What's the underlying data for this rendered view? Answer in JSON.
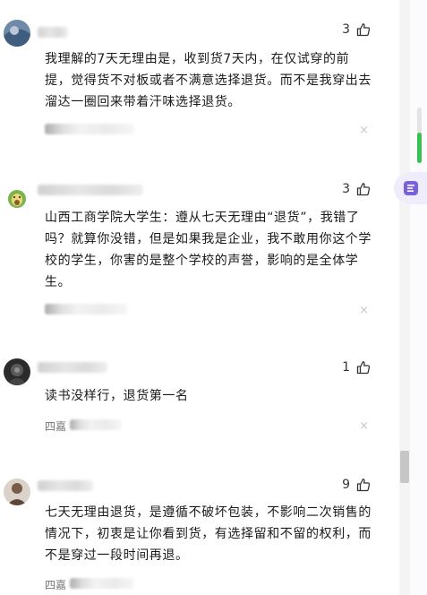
{
  "comments": [
    {
      "likes": "3",
      "text": "我理解的7天无理由是，收到货7天内，在仅试穿的前提，觉得货不对板或者不满意选择退货。而不是我穿出去溜达一圈回来带着汗味选择退货。"
    },
    {
      "likes": "3",
      "text": "山西工商学院大学生：遵从七天无理由“退货”，我错了吗？就算你没错，但是如果我是企业，我不敢用你这个学校的学生，你害的是整个学校的声誉，影响的是全体学生。"
    },
    {
      "likes": "1",
      "text": "读书没样行，退货第一名",
      "meta": "四嘉"
    },
    {
      "likes": "9",
      "text": "七天无理由退货，是遵循不破坏包装，不影响二次销售的情况下，初衷是让你看到货，有选择留和不留的权利，而不是穿过一段时间再退。",
      "meta": "四嘉"
    }
  ],
  "close_glyph": "×",
  "sidebar": {
    "progress_fraction": 0.55,
    "progress_color": "#37c24f"
  },
  "icons": {
    "like": "thumbs-up-icon",
    "close": "close-icon",
    "tool": "document-tool-icon"
  }
}
